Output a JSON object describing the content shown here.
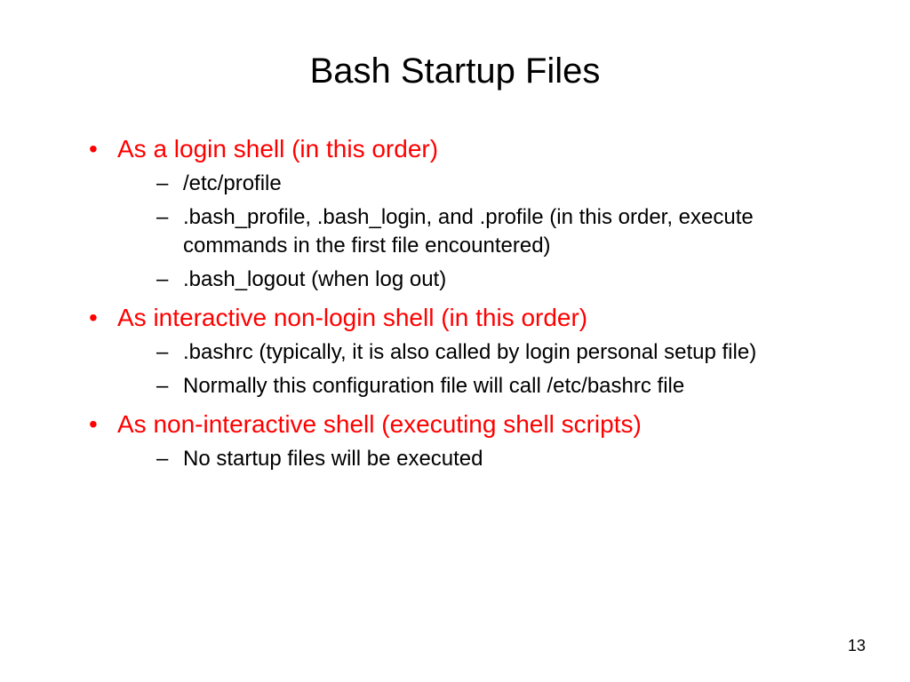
{
  "slide": {
    "title": "Bash Startup Files",
    "pageNumber": "13",
    "sections": [
      {
        "heading": "As a login shell (in this order)",
        "items": [
          "/etc/profile",
          ".bash_profile, .bash_login, and .profile (in this order, execute commands in the first file encountered)",
          ".bash_logout (when log out)"
        ]
      },
      {
        "heading": "As interactive non-login shell (in this order)",
        "items": [
          ".bashrc (typically, it is also called by login personal setup file)",
          "Normally this configuration file will call /etc/bashrc file"
        ]
      },
      {
        "heading": "As non-interactive shell (executing shell scripts)",
        "items": [
          "No startup files will be executed"
        ]
      }
    ]
  }
}
